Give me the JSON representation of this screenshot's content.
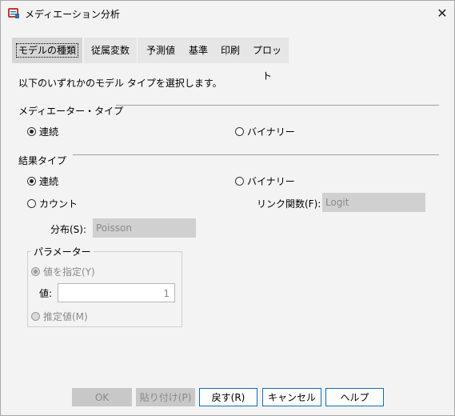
{
  "window": {
    "title": "メディエーション分析",
    "close_glyph": "✕"
  },
  "tabs": [
    {
      "label": "モデルの種類"
    },
    {
      "label": "従属変数"
    },
    {
      "label": "予測値"
    },
    {
      "label": "基準"
    },
    {
      "label": "印刷"
    },
    {
      "label": "プロット"
    }
  ],
  "intro": "以下のいずれかのモデル タイプを選択します。",
  "mediator": {
    "section_label": "メディエーター・タイプ",
    "options": [
      {
        "label": "連続",
        "selected": true
      },
      {
        "label": "バイナリー",
        "selected": false
      }
    ]
  },
  "outcome": {
    "section_label": "結果タイプ",
    "options": [
      {
        "label": "連続",
        "selected": true
      },
      {
        "label": "バイナリー",
        "selected": false
      },
      {
        "label": "カウント",
        "selected": false
      }
    ],
    "link_label": "リンク関数(F):",
    "link_value": "Logit",
    "dist_label": "分布(S):",
    "dist_value": "Poisson"
  },
  "parameter": {
    "group_label": "パラメーター",
    "specify_label": "値を指定(Y)",
    "value_label": "値:",
    "value": "1",
    "estimate_label": "推定値(M)"
  },
  "buttons": {
    "ok": "OK",
    "paste": "貼り付け(P)",
    "reset": "戻す(R)",
    "cancel": "キャンセル",
    "help": "ヘルプ"
  },
  "colors": {
    "accent": "#0f6cbd"
  }
}
